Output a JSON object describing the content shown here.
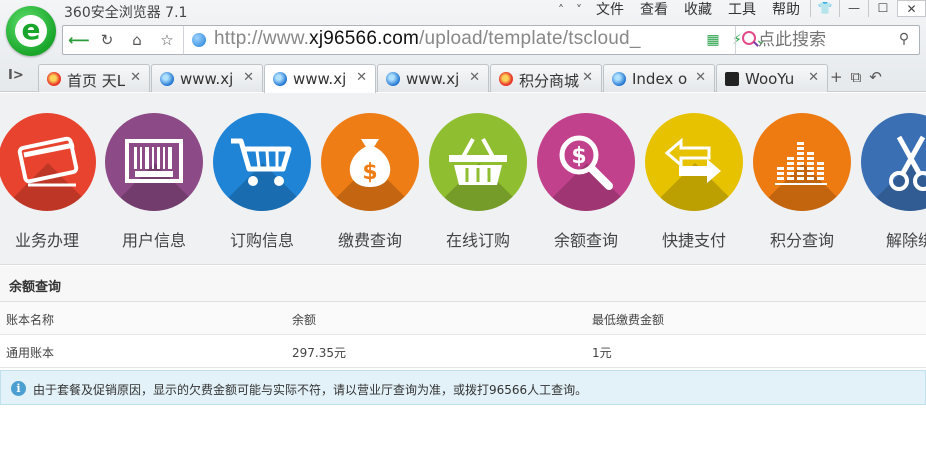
{
  "browser": {
    "title": "360安全浏览器 7.1",
    "menus": [
      "文件",
      "查看",
      "收藏",
      "工具",
      "帮助"
    ],
    "window_buttons": [
      "👕",
      "—",
      "☐",
      "✕"
    ],
    "url_gray_1": "http://www.",
    "url_dark": "xj96566.com",
    "url_gray_2": "/upload/template/tscloud_",
    "search_placeholder": "点此搜索",
    "tabs": [
      {
        "label": "首页 天L",
        "favicon": "fire"
      },
      {
        "label": "www.xj",
        "favicon": "ie"
      },
      {
        "label": "www.xj",
        "favicon": "ie",
        "active": true
      },
      {
        "label": "www.xj",
        "favicon": "ie"
      },
      {
        "label": "积分商城",
        "favicon": "fire"
      },
      {
        "label": "Index o",
        "favicon": "ie"
      },
      {
        "label": "WooYu",
        "favicon": "woo"
      }
    ]
  },
  "services": [
    {
      "name": "业务办理",
      "color": "#e8432f",
      "icon": "card-icon"
    },
    {
      "name": "用户信息",
      "color": "#8c4a86",
      "icon": "barcode-icon"
    },
    {
      "name": "订购信息",
      "color": "#1f84d6",
      "icon": "cart-icon"
    },
    {
      "name": "缴费查询",
      "color": "#ef7d15",
      "icon": "money-bag-icon"
    },
    {
      "name": "在线订购",
      "color": "#8fbf31",
      "icon": "basket-icon"
    },
    {
      "name": "余额查询",
      "color": "#c2418c",
      "icon": "magnifier-dollar-icon"
    },
    {
      "name": "快捷支付",
      "color": "#e6c200",
      "icon": "arrows-icon"
    },
    {
      "name": "积分查询",
      "color": "#ee7a12",
      "icon": "equalizer-icon"
    },
    {
      "name": "解除绑",
      "color": "#3b6fb4",
      "icon": "scissors-icon"
    }
  ],
  "section": {
    "title": "余额查询"
  },
  "table": {
    "headers": [
      "账本名称",
      "余额",
      "最低缴费金额"
    ],
    "rows": [
      [
        "通用账本",
        "297.35元",
        "1元"
      ]
    ]
  },
  "notice": {
    "icon": "info-icon",
    "text": "由于套餐及促销原因，显示的欠费金额可能与实际不符，请以营业厅查询为准，或拨打96566人工查询。"
  }
}
